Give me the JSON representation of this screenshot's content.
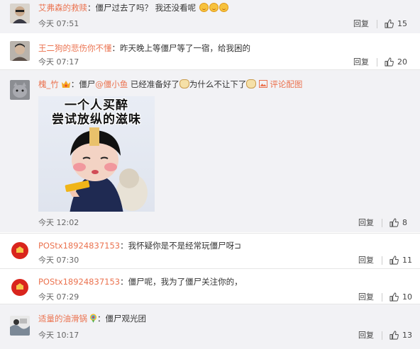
{
  "comments": [
    {
      "user": "艾弗森的救赎",
      "colon": "：",
      "text": "僵尸过去了吗？ 我还没看呢",
      "time": "今天 07:51",
      "reply": "回复",
      "likes": "15"
    },
    {
      "user": "王二狗的悲伤你不懂",
      "colon": "：",
      "text": "昨天晚上等僵尸等了一宿，给我困的",
      "time": "今天 07:17",
      "reply": "回复",
      "likes": "20"
    },
    {
      "user": "槐_竹",
      "colon": "：",
      "text_a": "僵尸",
      "mention": "@僵小鱼",
      "text_b": " 已经准备好了",
      "text_c": "为什么不让下了",
      "pic_link": "评论配图",
      "sticker_line1": "一个人买醉",
      "sticker_line2": "尝试放纵的滋味",
      "time": "今天 12:02",
      "reply": "回复",
      "likes": "8"
    },
    {
      "user": "POStx18924837153",
      "colon": "：",
      "text": "我怀疑你是不是经常玩僵尸呀⊐",
      "time": "今天 07:30",
      "reply": "回复",
      "likes": "11"
    },
    {
      "user": "POStx18924837153",
      "colon": "：",
      "text": "僵尸呢，我为了僵尸关注你的，",
      "time": "今天 07:29",
      "reply": "回复",
      "likes": "10"
    },
    {
      "user": "适量的油滑锅",
      "colon": "：",
      "text": "僵尸观光团",
      "time": "今天 10:17",
      "reply": "回复",
      "likes": "13"
    }
  ],
  "colors": {
    "username": "#eb7350",
    "shaded_bg": "#f2f2f5"
  }
}
